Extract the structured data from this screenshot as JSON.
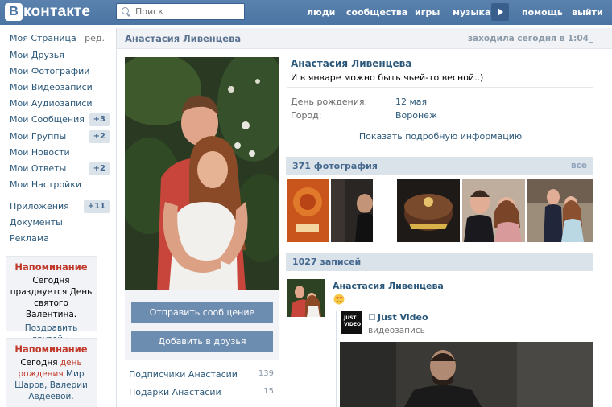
{
  "header": {
    "logo_letter": "В",
    "logo_text": "контакте",
    "search_placeholder": "Поиск",
    "nav": [
      "люди",
      "сообщества",
      "игры",
      "музыка",
      "помощь",
      "выйти"
    ]
  },
  "sidebar": {
    "items": [
      {
        "label": "Моя Страница",
        "extra": "ред."
      },
      {
        "label": "Мои Друзья"
      },
      {
        "label": "Мои Фотографии"
      },
      {
        "label": "Мои Видеозаписи"
      },
      {
        "label": "Мои Аудиозаписи"
      },
      {
        "label": "Мои Сообщения",
        "badge": "+3"
      },
      {
        "label": "Мои Группы",
        "badge": "+2"
      },
      {
        "label": "Мои Новости"
      },
      {
        "label": "Мои Ответы",
        "badge": "+2"
      },
      {
        "label": "Мои Настройки"
      }
    ],
    "items2": [
      {
        "label": "Приложения",
        "badge": "+11"
      },
      {
        "label": "Документы"
      },
      {
        "label": "Реклама"
      }
    ],
    "reminders": [
      {
        "title": "Напоминание",
        "text": "Сегодня празднуется День святого Валентина.",
        "link": "Поздравить друзей »"
      },
      {
        "title": "Напоминание",
        "text_before": "Сегодня ",
        "text_mid": "день рождения",
        "text_links": " Мир Шаров, Валерии Авдеевой."
      }
    ]
  },
  "profile": {
    "header_name": "Анастасия Ливенцева",
    "last_seen": "заходила сегодня в 1:04",
    "name": "Анастасия Ливенцева",
    "status": "И в январе можно быть чьей-то весной..)",
    "birthday_label": "День рождения:",
    "birthday_value": "12 мая",
    "city_label": "Город:",
    "city_value": "Воронеж",
    "more_info": "Показать подробную информацию",
    "send_message": "Отправить сообщение",
    "add_friend": "Добавить в друзья",
    "subscribers_label": "Подписчики Анастасии",
    "subscribers_count": "139",
    "gifts_label": "Подарки Анастасии",
    "gifts_count": "15"
  },
  "photos": {
    "title": "371 фотография",
    "all": "все"
  },
  "wall": {
    "title": "1027 записей",
    "post_author": "Анастасия Ливенцева",
    "repost_logo": "JUST VIDEO",
    "repost_source": "Just Video",
    "repost_type": "видеозапись"
  },
  "colors": {
    "header": "#4a74a3",
    "link": "#2b587a",
    "reminder_title": "#c0392b",
    "button": "#6c8cb0",
    "section_bg": "#dae2ea"
  }
}
